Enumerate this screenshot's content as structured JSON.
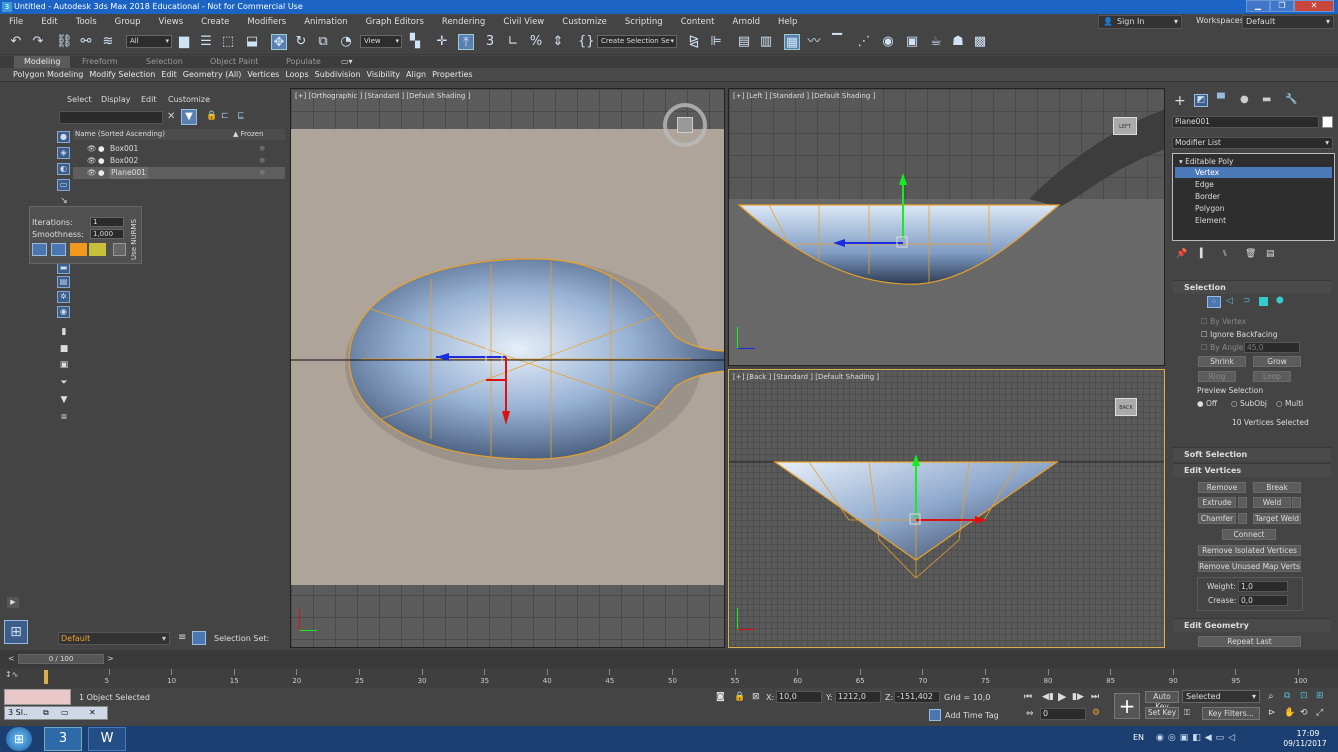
{
  "title": "Untitled - Autodesk 3ds Max 2018 Educational - Not for Commercial Use",
  "menu": [
    "File",
    "Edit",
    "Tools",
    "Group",
    "Views",
    "Create",
    "Modifiers",
    "Animation",
    "Graph Editors",
    "Rendering",
    "Civil View",
    "Customize",
    "Scripting",
    "Content",
    "Arnold",
    "Help"
  ],
  "signin": "Sign In",
  "workspaces_label": "Workspaces:",
  "workspaces_value": "Default",
  "toolbar": {
    "filter": "All",
    "refcoord": "View",
    "selset": "Create Selection Se"
  },
  "ribbon_tabs": [
    "Modeling",
    "Freeform",
    "Selection",
    "Object Paint",
    "Populate"
  ],
  "ribbon_items": [
    "Polygon Modeling",
    "Modify Selection",
    "Edit",
    "Geometry (All)",
    "Vertices",
    "Loops",
    "Subdivision",
    "Visibility",
    "Align",
    "Properties"
  ],
  "scene": {
    "tabs": [
      "Select",
      "Display",
      "Edit",
      "Customize"
    ],
    "header_name": "Name (Sorted Ascending)",
    "header_frozen": "▲ Frozen",
    "objects": [
      "Box001",
      "Box002",
      "Plane001"
    ]
  },
  "nurms": {
    "iterations_label": "Iterations:",
    "iterations": "1",
    "smoothness_label": "Smoothness:",
    "smoothness": "1,000",
    "use_nurms": "Use NURMS"
  },
  "layer": "Default",
  "selection_set_label": "Selection Set:",
  "viewports": {
    "top": "[+] [Orthographic ] [Standard ] [Default Shading ]",
    "left": "[+] [Left ] [Standard ] [Default Shading ]",
    "back": "[+] [Back ] [Standard ] [Default Shading ]",
    "viewcube_left": "LEFT",
    "viewcube_back": "BACK"
  },
  "command": {
    "object_name": "Plane001",
    "modifier_list": "Modifier List",
    "stack": [
      "Editable Poly",
      "Vertex",
      "Edge",
      "Border",
      "Polygon",
      "Element"
    ],
    "selection": {
      "header": "Selection",
      "by_vertex": "By Vertex",
      "ignore_backfacing": "Ignore Backfacing",
      "by_angle": "By Angle:",
      "angle": "45,0",
      "shrink": "Shrink",
      "grow": "Grow",
      "ring": "Ring",
      "loop": "Loop",
      "preview": "Preview Selection",
      "off": "Off",
      "subobj": "SubObj",
      "multi": "Multi",
      "status": "10 Vertices Selected"
    },
    "soft_selection": "Soft Selection",
    "edit_vertices": {
      "header": "Edit Vertices",
      "remove": "Remove",
      "break": "Break",
      "extrude": "Extrude",
      "weld": "Weld",
      "chamfer": "Chamfer",
      "target_weld": "Target Weld",
      "connect": "Connect",
      "remove_isolated": "Remove Isolated Vertices",
      "remove_unused": "Remove Unused Map Verts",
      "weight_label": "Weight:",
      "weight": "1,0",
      "crease_label": "Crease:",
      "crease": "0,0"
    },
    "edit_geometry": "Edit Geometry",
    "repeat_last": "Repeat Last"
  },
  "timeline": {
    "frame": "0 / 100",
    "ticks": [
      5,
      10,
      15,
      20,
      25,
      30,
      35,
      40,
      45,
      50,
      55,
      60,
      65,
      70,
      75,
      80,
      85,
      90,
      95,
      100
    ]
  },
  "status": {
    "selected": "1 Object Selected",
    "x_label": "X:",
    "x": "10,0",
    "y_label": "Y:",
    "y": "1212,0",
    "z_label": "Z:",
    "z": "-151,402",
    "grid": "Grid = 10,0",
    "add_time_tag": "Add Time Tag",
    "auto_key": "Auto Key",
    "set_key": "Set Key",
    "key_mode": "Selected",
    "key_filters": "Key Filters...",
    "frame_field": "0",
    "mini_script": "Sl.."
  },
  "taskbar": {
    "lang": "EN",
    "time": "17:09",
    "date": "09/11/2017"
  }
}
